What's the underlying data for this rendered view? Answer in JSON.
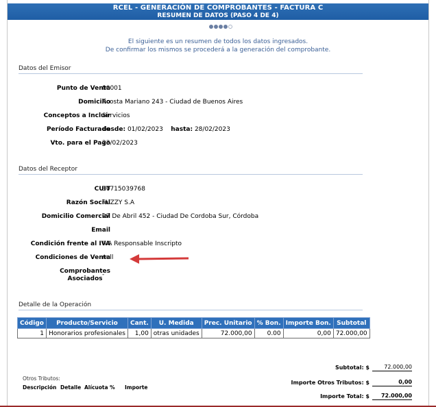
{
  "header": {
    "title": "RCEL - GENERACIÓN DE COMPROBANTES - FACTURA C",
    "subtitle": "RESUMEN DE DATOS (PASO 4 DE 4)"
  },
  "progress": {
    "total_steps": 5,
    "filled_steps": 4
  },
  "intro": {
    "line1": "El siguiente es un resumen de todos los datos ingresados.",
    "line2": "De confirmar los mismos se procederá a la generación del comprobante."
  },
  "emisor": {
    "title": "Datos del Emisor",
    "punto_venta_label": "Punto de Venta",
    "punto_venta": "00001",
    "domicilio_label": "Domicilio",
    "domicilio": "Acosta Mariano 243 - Ciudad de Buenos Aires",
    "conceptos_label": "Conceptos a Incluír",
    "conceptos": "Servicios",
    "periodo_label": "Período Facturado",
    "desde_label": "desde:",
    "desde": "01/02/2023",
    "hasta_label": "hasta:",
    "hasta": "28/02/2023",
    "vto_label": "Vto. para el Pago",
    "vto": "23/02/2023"
  },
  "receptor": {
    "title": "Datos del Receptor",
    "cuit_label": "CUIT",
    "cuit": "30715039768",
    "razon_label": "Razón Social",
    "razon": "FUZZY S.A",
    "domicilio_label": "Domicilio Comercial",
    "domicilio": "27 De Abril 452 - Ciudad De Cordoba Sur, Córdoba",
    "email_label": "Email",
    "email": "",
    "iva_label": "Condición frente al IVA",
    "iva": "IVA Responsable Inscripto",
    "venta_label": "Condiciones de Venta",
    "venta": "null",
    "comprobantes_label_1": "Comprobantes",
    "comprobantes_label_2": "Asociados",
    "comprobantes": "-"
  },
  "operacion": {
    "title": "Detalle de la Operación",
    "columns": [
      "Código",
      "Producto/Servicio",
      "Cant.",
      "U. Medida",
      "Prec. Unitario",
      "% Bon.",
      "Importe Bon.",
      "Subtotal"
    ],
    "rows": [
      [
        "1",
        "Honorarios profesionales",
        "1,00",
        "otras unidades",
        "72.000,00",
        "0.00",
        "0,00",
        "72.000,00"
      ]
    ]
  },
  "totales": {
    "subtotal_label": "Subtotal: $",
    "subtotal": "72.000,00",
    "otros_label": "Importe Otros Tributos: $",
    "otros": "0,00",
    "total_label": "Importe Total: $",
    "total": "72.000,00"
  },
  "otros_tributos": {
    "title": "Otros Tributos:",
    "col_descripcion": "Descripción",
    "col_detalle": "Detalle",
    "col_alicuota": "Alícuota %",
    "col_importe": "Importe"
  },
  "colors": {
    "header_blue": "#1f5ea5",
    "table_header_blue": "#2f70bb",
    "intro_text": "#3a5f96",
    "annotation_arrow": "#d43a3a"
  }
}
